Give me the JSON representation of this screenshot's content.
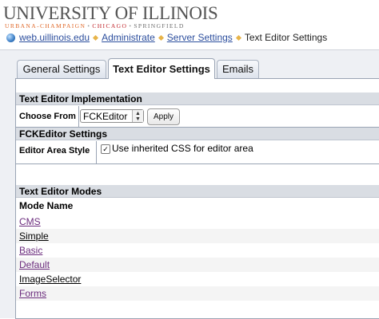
{
  "header": {
    "logo": "UNIVERSITY OF ILLINOIS",
    "campus": [
      "URBANA-CHAMPAIGN",
      "CHICAGO",
      "SPRINGFIELD"
    ],
    "colors": {
      "campus1": "#e06a2c",
      "campus2": "#c1272d",
      "campus3": "#6d6d6d"
    }
  },
  "breadcrumb": {
    "items": [
      "web.uillinois.edu",
      "Administrate",
      "Server Settings"
    ],
    "current": "Text Editor Settings"
  },
  "tabs": [
    {
      "label": "General Settings",
      "active": false
    },
    {
      "label": "Text Editor Settings",
      "active": true
    },
    {
      "label": "Emails",
      "active": false
    }
  ],
  "implementation": {
    "title": "Text Editor Implementation",
    "choose_label": "Choose From",
    "selected": "FCKEditor",
    "apply_label": "Apply"
  },
  "fck_settings": {
    "title": "FCKEditor Settings",
    "style_label": "Editor Area Style",
    "checkbox_label": "Use inherited CSS for editor area",
    "checked": true
  },
  "modes": {
    "title": "Text Editor Modes",
    "column_header": "Mode Name",
    "items": [
      "CMS",
      "Simple",
      "Basic",
      "Default",
      "ImageSelector",
      "Forms"
    ]
  }
}
